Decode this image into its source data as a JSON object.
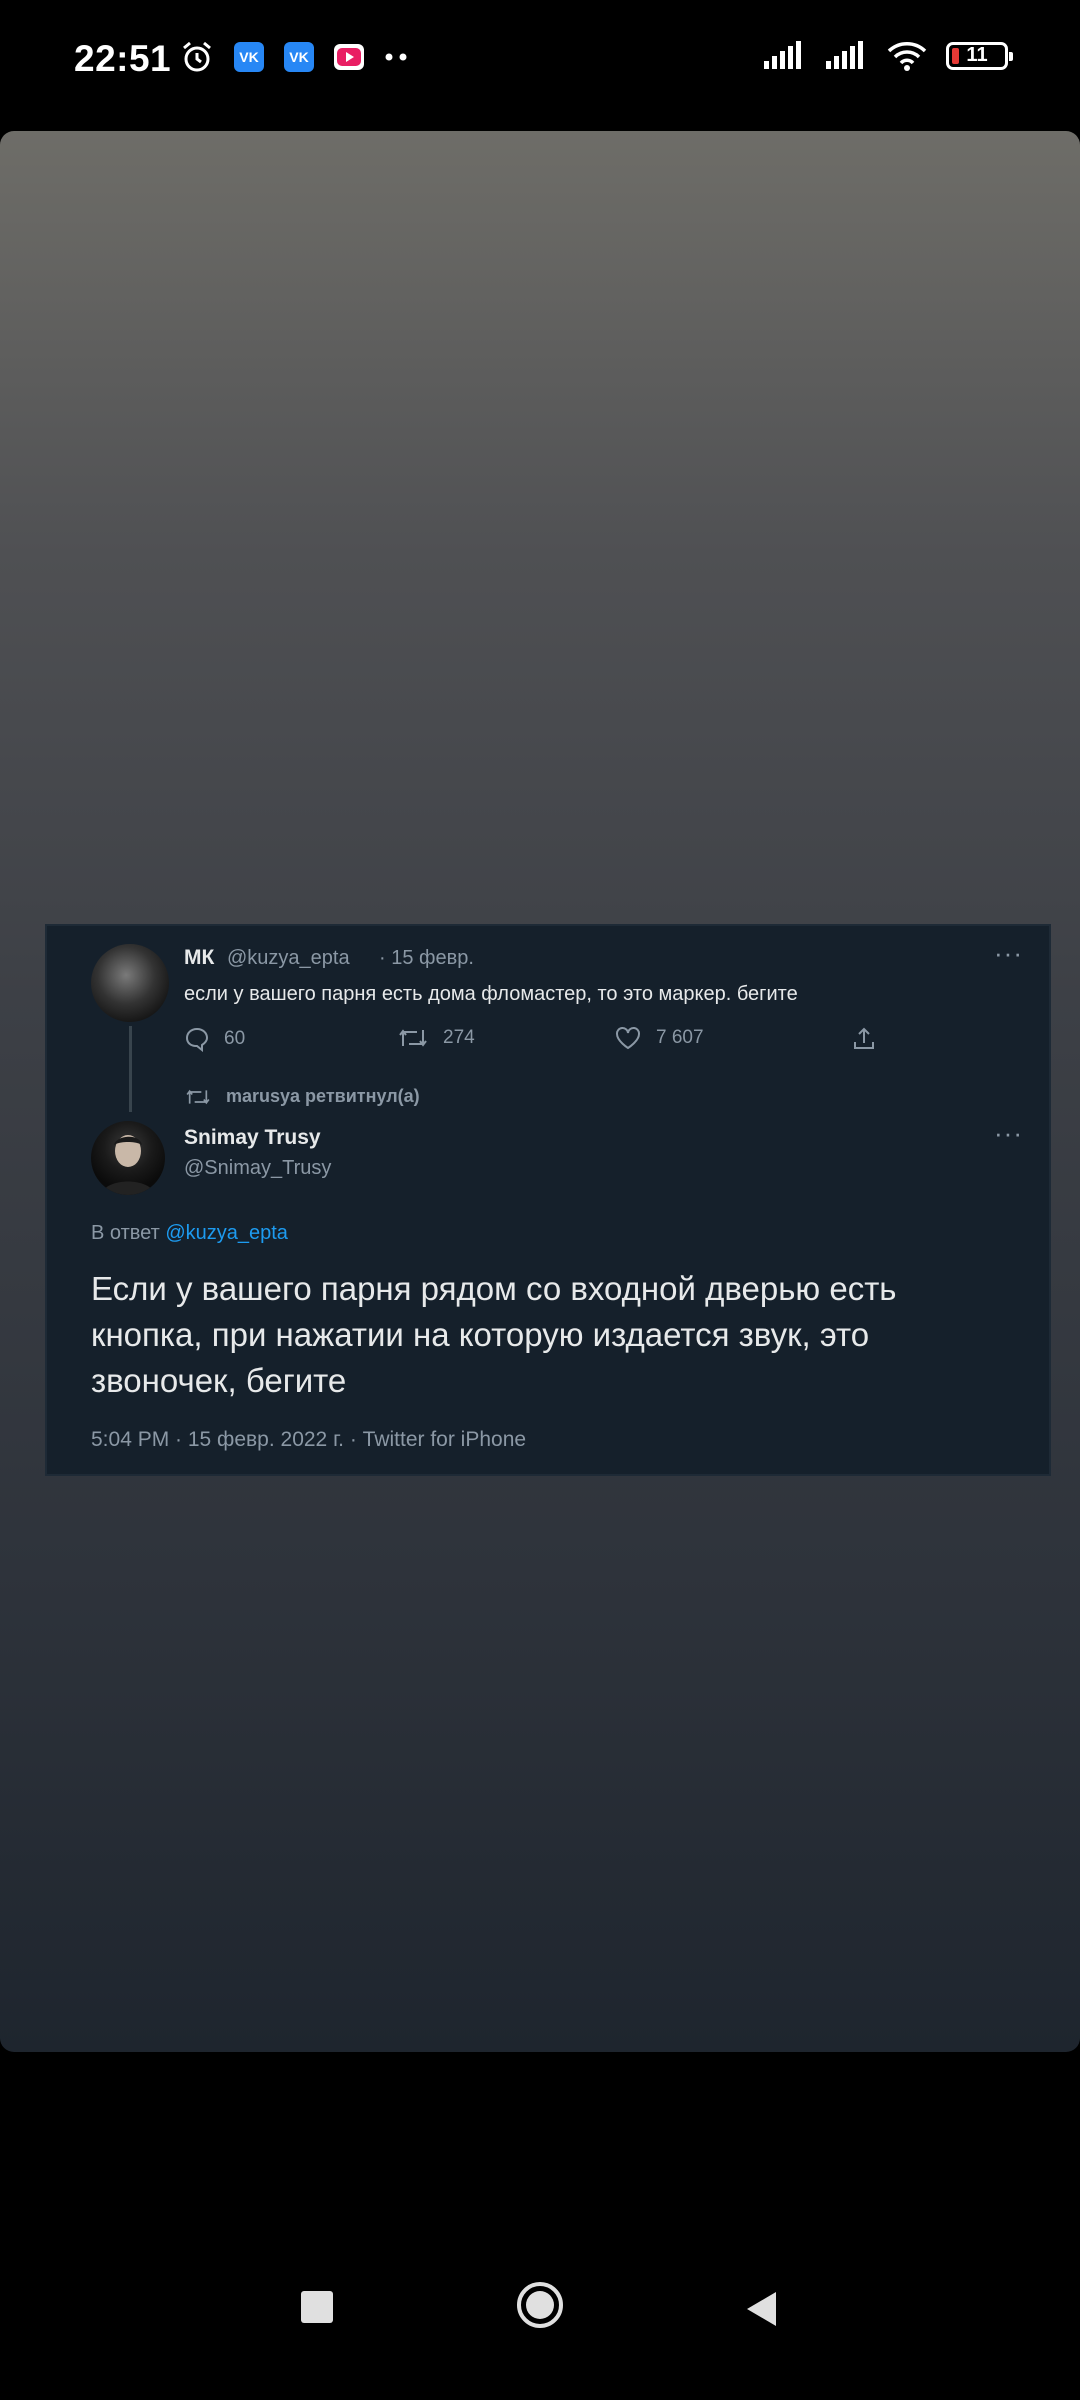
{
  "status_bar": {
    "time": "22:51",
    "vk_label": "VK",
    "battery_level": "11",
    "icons_left": [
      "alarm-icon",
      "vk-icon",
      "vk-icon",
      "video-icon",
      "more-dots-icon"
    ],
    "icons_right": [
      "signal-icon",
      "signal-icon",
      "wifi-icon",
      "battery-icon"
    ]
  },
  "tweet_parent": {
    "name": "МК",
    "handle": "@kuzya_epta",
    "date": "· 15 февр.",
    "text": "если у вашего парня есть дома фломастер, то это маркер. бегите",
    "replies": "60",
    "retweets": "274",
    "likes": "7 607"
  },
  "retweet_note": "marusya ретвитнул(а)",
  "tweet_main": {
    "name": "Snimay Trusy",
    "handle": "@Snimay_Trusy",
    "reply_prefix": "В ответ",
    "reply_mention": "@kuzya_epta",
    "text": "Если у вашего парня рядом со входной дверью есть кнопка, при нажатии на которую издается звук, это звоночек, бегите",
    "meta": "5:04 PM · 15 февр. 2022 г. · Twitter for iPhone"
  },
  "more_glyph": "···",
  "colors": {
    "tweet_bg": "#15202b",
    "text_primary": "#e7e9ea",
    "text_secondary": "#8b98a5",
    "link": "#1d9bf0",
    "battery_low": "#e53935"
  }
}
